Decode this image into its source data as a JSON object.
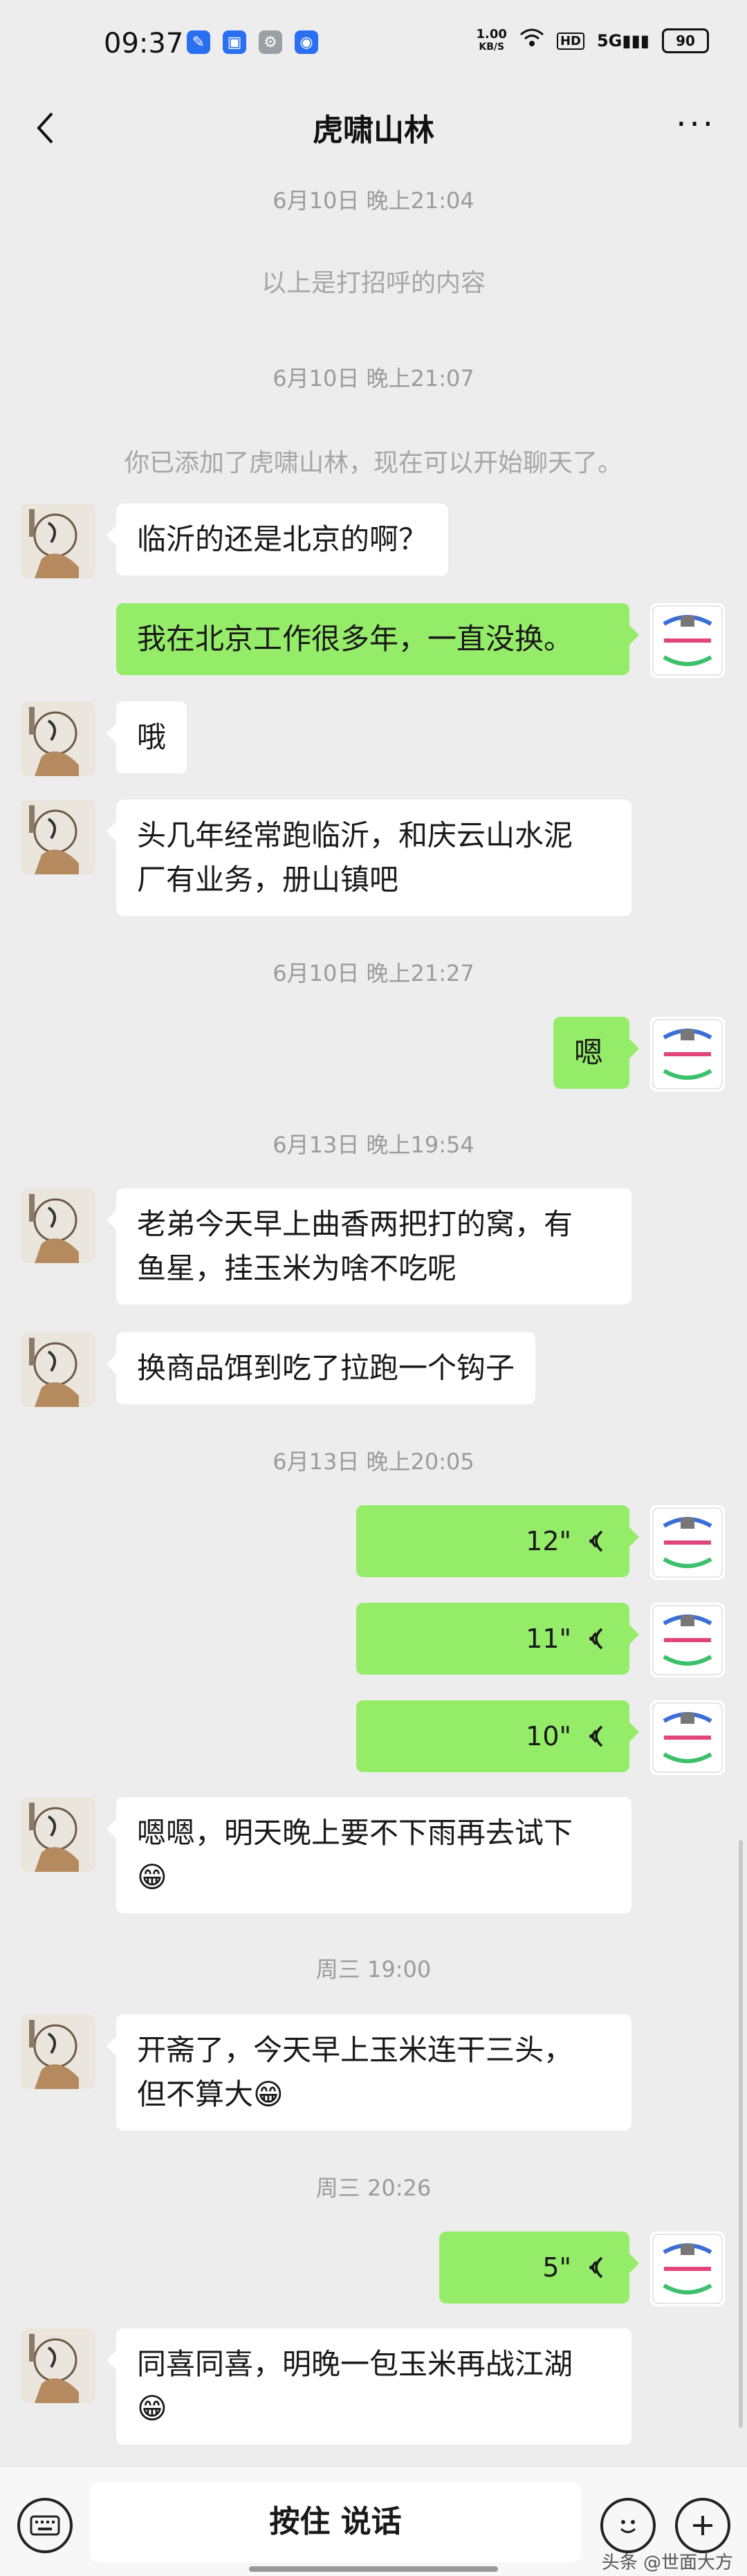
{
  "status_bar": {
    "time": "09:37",
    "net_speed_value": "1.00",
    "net_speed_unit": "KB/S",
    "hd_badge": "HD",
    "signal": "5G",
    "battery": "90"
  },
  "header": {
    "title": "虎啸山林",
    "more_label": "···"
  },
  "messages": [
    {
      "kind": "time",
      "text": "6月10日 晚上21:04"
    },
    {
      "kind": "system",
      "text": "以上是打招呼的内容"
    },
    {
      "kind": "time",
      "text": "6月10日 晚上21:07"
    },
    {
      "kind": "system",
      "text": "你已添加了虎啸山林，现在可以开始聊天了。"
    },
    {
      "kind": "incoming",
      "text": "临沂的还是北京的啊？"
    },
    {
      "kind": "outgoing",
      "text": "我在北京工作很多年，一直没换。"
    },
    {
      "kind": "incoming",
      "text": "哦"
    },
    {
      "kind": "incoming",
      "text_line1": "头几年经常跑临沂，和庆云山水泥",
      "text_line2": "厂有业务，册山镇吧"
    },
    {
      "kind": "time",
      "text": "6月10日 晚上21:27"
    },
    {
      "kind": "outgoing",
      "text": "嗯"
    },
    {
      "kind": "time",
      "text": "6月13日 晚上19:54"
    },
    {
      "kind": "incoming",
      "text_line1": "老弟今天早上曲香两把打的窝，有",
      "text_line2": "鱼星，挂玉米为啥不吃呢"
    },
    {
      "kind": "incoming",
      "text": "换商品饵到吃了拉跑一个钩子"
    },
    {
      "kind": "time",
      "text": "6月13日 晚上20:05"
    },
    {
      "kind": "voice",
      "duration": "12\""
    },
    {
      "kind": "voice",
      "duration": "11\""
    },
    {
      "kind": "voice",
      "duration": "10\""
    },
    {
      "kind": "incoming",
      "text_line1": "嗯嗯，明天晚上要不下雨再去试下",
      "text_line2": "😁"
    },
    {
      "kind": "time",
      "text": "周三 19:00"
    },
    {
      "kind": "incoming",
      "text_line1": "开斋了，今天早上玉米连干三头，",
      "text_line2": "但不算大😁"
    },
    {
      "kind": "time",
      "text": "周三 20:26"
    },
    {
      "kind": "voice",
      "duration": "5\""
    },
    {
      "kind": "incoming",
      "text_line1": "同喜同喜，明晚一包玉米再战江湖",
      "text_line2": "😁"
    }
  ],
  "bottom_bar": {
    "hold_to_talk": "按住 说话",
    "watermark": "头条 @世面大方"
  },
  "colors": {
    "background": "#ededed",
    "outgoing_bubble": "#95ec69",
    "incoming_bubble": "#ffffff",
    "timestamp_text": "#9b9b9b"
  }
}
